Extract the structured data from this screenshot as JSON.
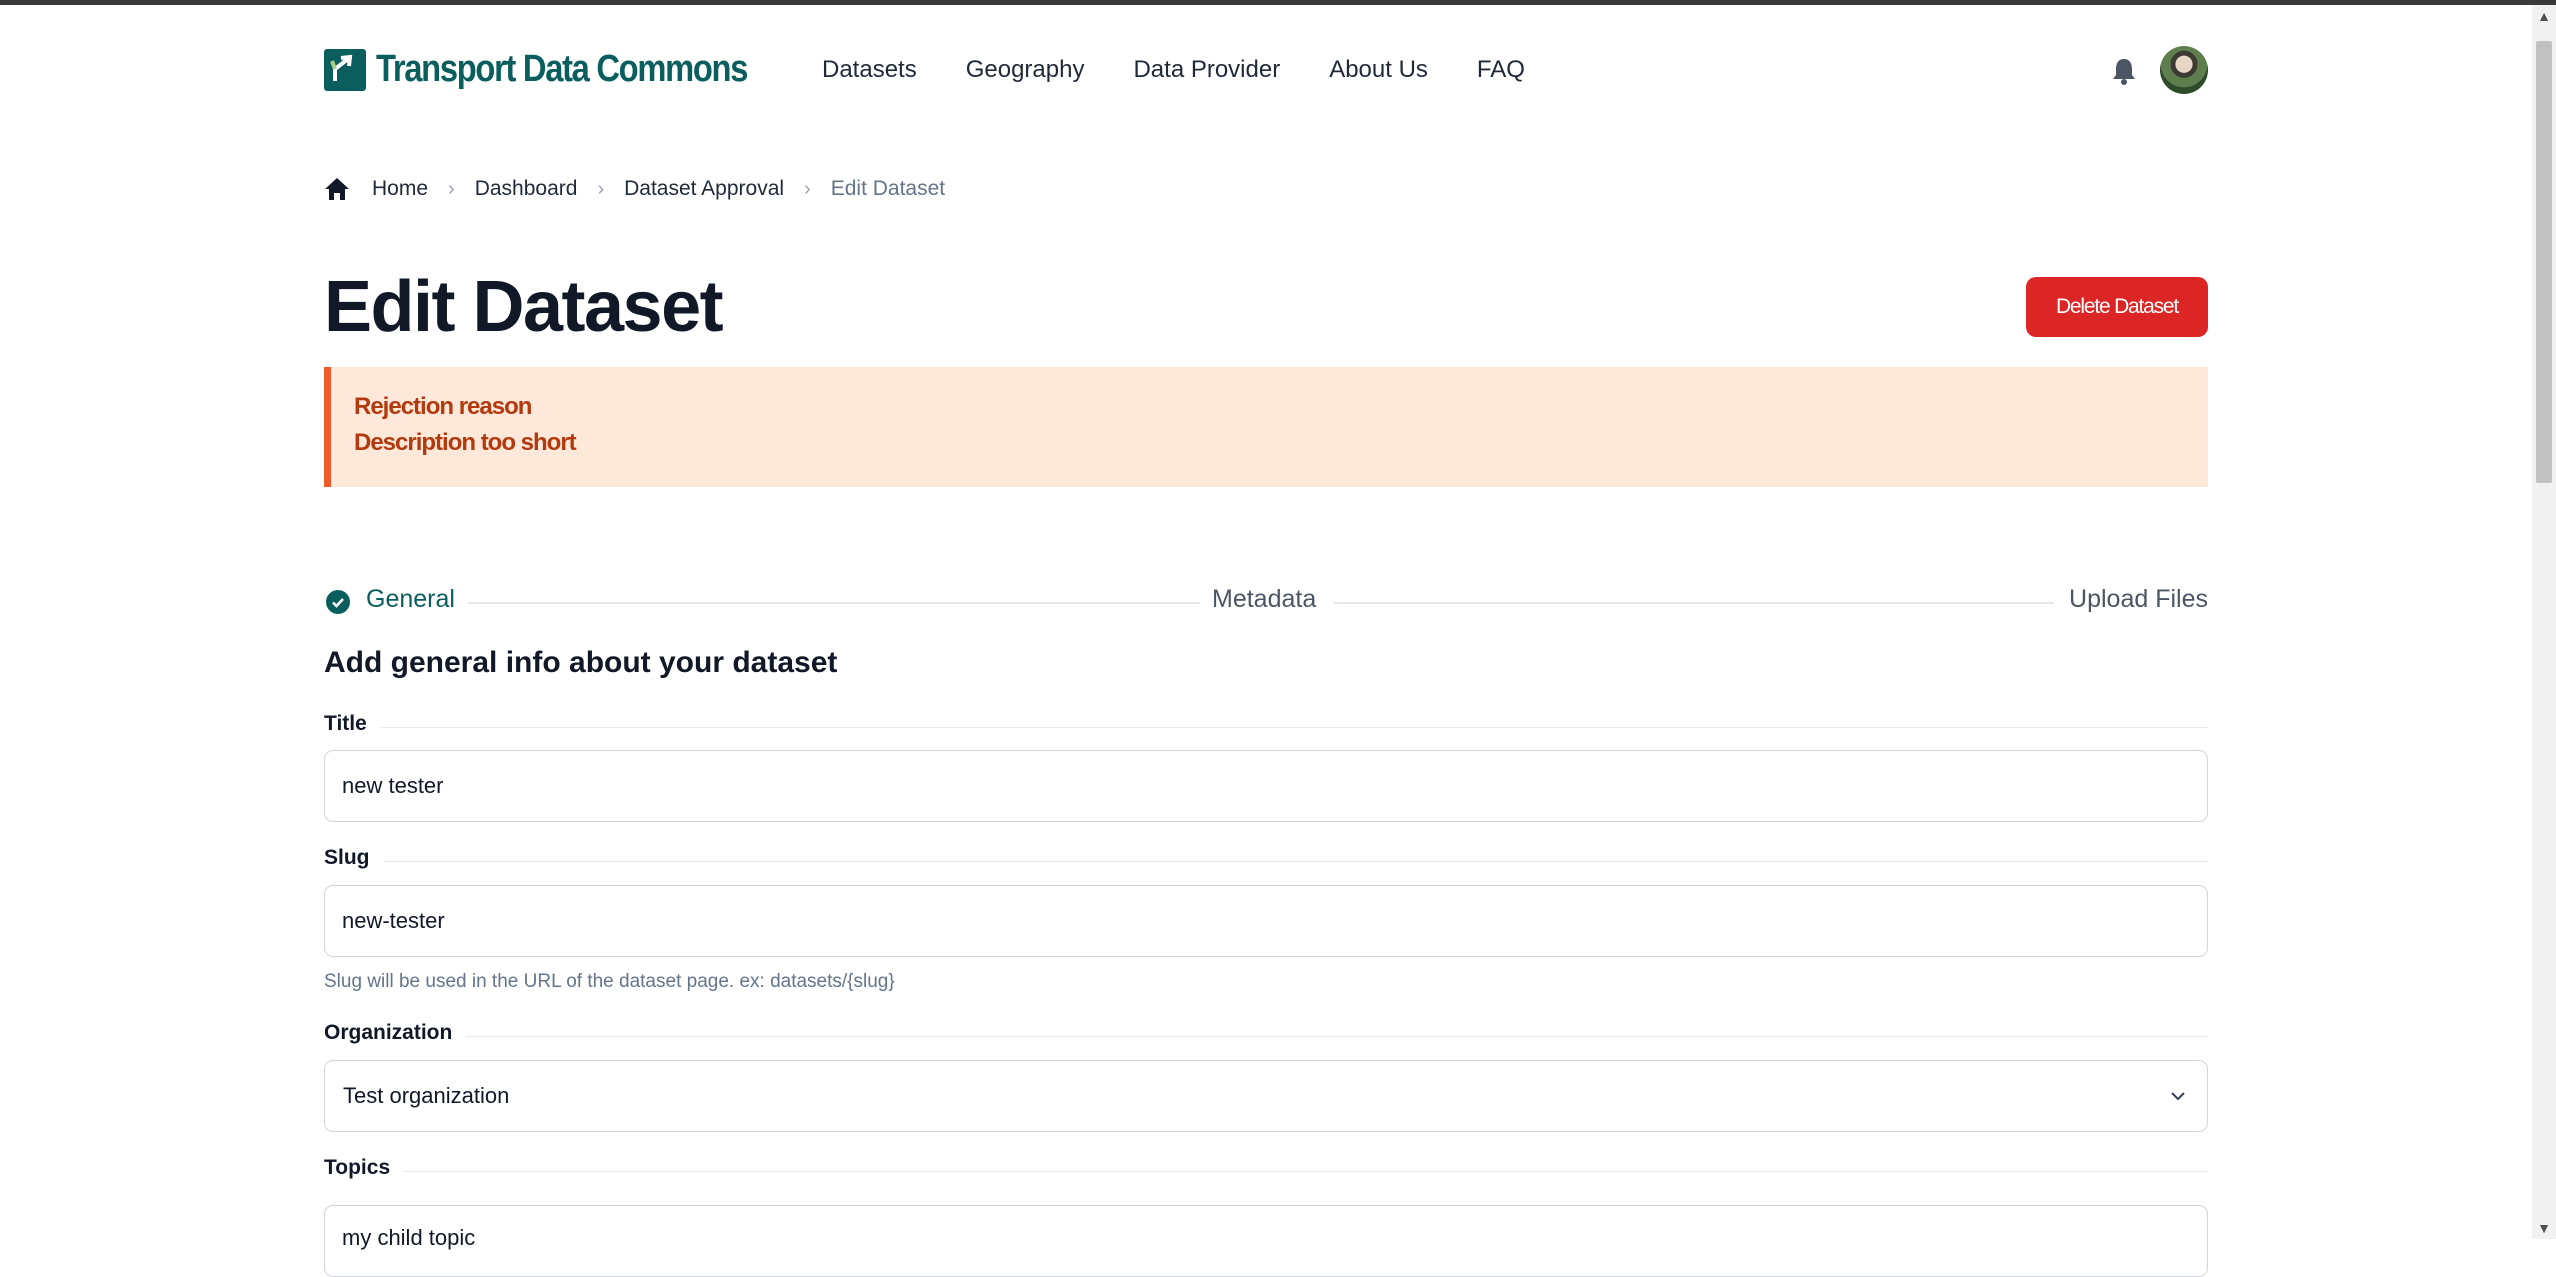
{
  "brand": {
    "name": "Transport Data Commons",
    "color": "#0b5e5e"
  },
  "nav": [
    {
      "label": "Datasets"
    },
    {
      "label": "Geography"
    },
    {
      "label": "Data Provider"
    },
    {
      "label": "About Us"
    },
    {
      "label": "FAQ"
    }
  ],
  "header_icons": {
    "notifications": "bell-icon",
    "profile": "avatar"
  },
  "breadcrumb": {
    "home": "Home",
    "dashboard": "Dashboard",
    "approval": "Dataset Approval",
    "current": "Edit Dataset"
  },
  "page": {
    "title": "Edit Dataset",
    "delete_label": "Delete Dataset",
    "delete_color": "#dc2626"
  },
  "alert": {
    "title": "Rejection reason",
    "message": "Description too short",
    "accent": "#f05a28"
  },
  "stepper": {
    "steps": [
      {
        "label": "General",
        "state": "complete"
      },
      {
        "label": "Metadata",
        "state": "pending"
      },
      {
        "label": "Upload Files",
        "state": "pending"
      }
    ]
  },
  "form": {
    "heading": "Add general info about your dataset",
    "title_label": "Title",
    "title_value": "new tester",
    "slug_label": "Slug",
    "slug_value": "new-tester",
    "slug_hint": "Slug will be used in the URL of the dataset page. ex: datasets/{slug}",
    "organization_label": "Organization",
    "organization_value": "Test organization",
    "topics_label": "Topics",
    "topics_value": "my child topic"
  }
}
